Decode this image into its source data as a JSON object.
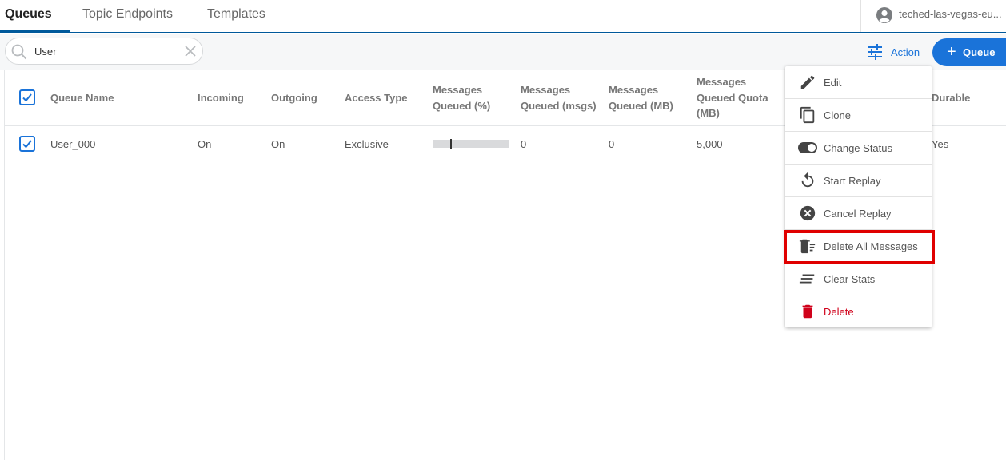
{
  "tabs": [
    {
      "label": "Queues",
      "active": true
    },
    {
      "label": "Topic Endpoints",
      "active": false
    },
    {
      "label": "Templates",
      "active": false
    }
  ],
  "account": {
    "name": "teched-las-vegas-eu..."
  },
  "search": {
    "value": "User",
    "icon": "search-icon"
  },
  "toolbar": {
    "action_label": "Action",
    "add_queue_label": "Queue"
  },
  "table": {
    "columns": [
      {
        "label": "Queue Name"
      },
      {
        "label": "Incoming"
      },
      {
        "label": "Outgoing"
      },
      {
        "label": "Access Type"
      },
      {
        "label": "Messages Queued (%)"
      },
      {
        "label": "Messages Queued (msgs)"
      },
      {
        "label": "Messages Queued (MB)"
      },
      {
        "label": "Messages Queued Quota (MB)"
      },
      {
        "label": "Durable"
      }
    ],
    "rows": [
      {
        "checked": true,
        "queue_name": "User_000",
        "incoming": "On",
        "outgoing": "On",
        "access_type": "Exclusive",
        "messages_queued_pct": 0.0,
        "messages_queued_msgs": "0",
        "messages_queued_mb": "0",
        "quota_mb": "5,000",
        "durable": "Yes"
      }
    ]
  },
  "menu": {
    "items": [
      {
        "label": "Edit",
        "icon": "pencil-icon"
      },
      {
        "label": "Clone",
        "icon": "copy-icon"
      },
      {
        "label": "Change Status",
        "icon": "toggle-icon"
      },
      {
        "label": "Start Replay",
        "icon": "replay-icon"
      },
      {
        "label": "Cancel Replay",
        "icon": "cancel-circle-icon"
      },
      {
        "label": "Delete All Messages",
        "icon": "delete-messages-icon",
        "highlighted": true
      },
      {
        "label": "Clear Stats",
        "icon": "clear-stats-icon"
      },
      {
        "label": "Delete",
        "icon": "trash-icon",
        "danger": true
      }
    ]
  },
  "colors": {
    "accent": "#1a73d9",
    "danger": "#d0021b",
    "highlight": "#e00000"
  }
}
